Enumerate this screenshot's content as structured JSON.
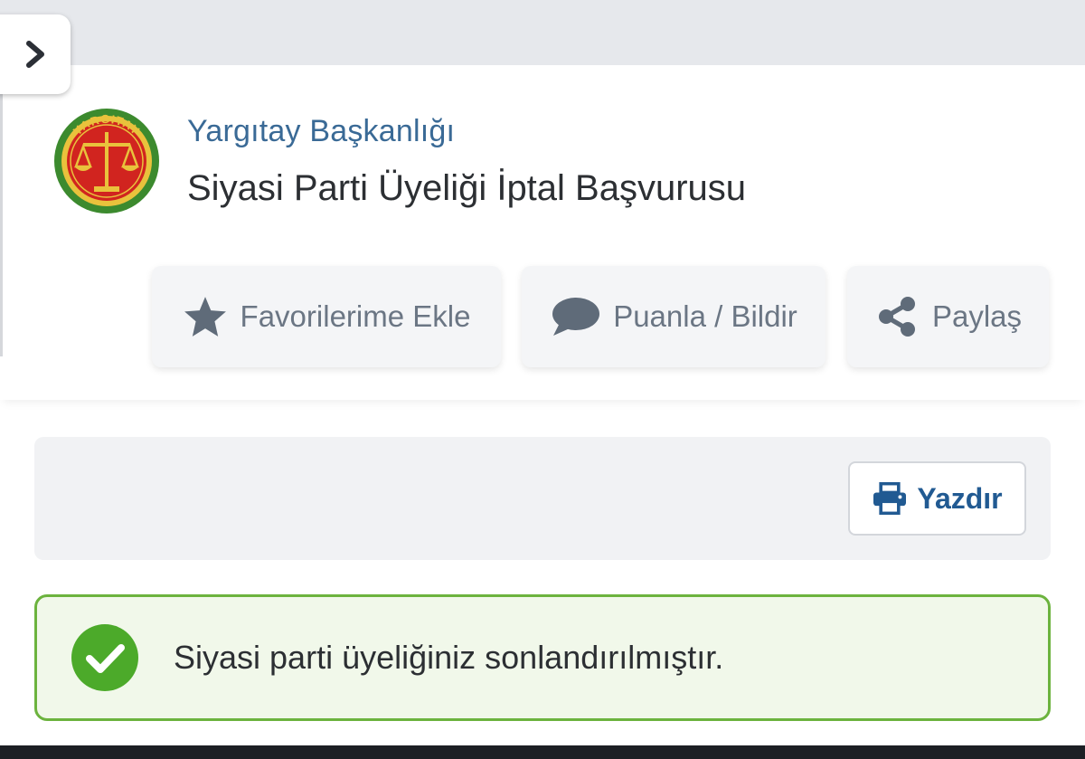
{
  "header": {
    "organization": "Yargıtay Başkanlığı",
    "service_title": "Siyasi Parti Üyeliği İptal Başvurusu",
    "logo_icon": "yargitay-seal-icon",
    "logo_text": "YARGITAY"
  },
  "sidebar_toggle": {
    "icon": "chevron-right-icon"
  },
  "actions": [
    {
      "label": "Favorilerime Ekle",
      "icon": "star-icon"
    },
    {
      "label": "Puanla / Bildir",
      "icon": "speech-bubble-icon"
    },
    {
      "label": "Paylaş",
      "icon": "share-icon"
    }
  ],
  "print": {
    "label": "Yazdır",
    "icon": "printer-icon"
  },
  "alert": {
    "message": "Siyasi parti üyeliğiniz sonlandırılmıştır.",
    "icon": "check-circle-icon",
    "status": "success"
  },
  "colors": {
    "link_blue": "#3a6a96",
    "print_blue": "#215a92",
    "success_green": "#6cb33e",
    "success_bg": "#f1f8ea",
    "icon_gray": "#6b7684"
  }
}
